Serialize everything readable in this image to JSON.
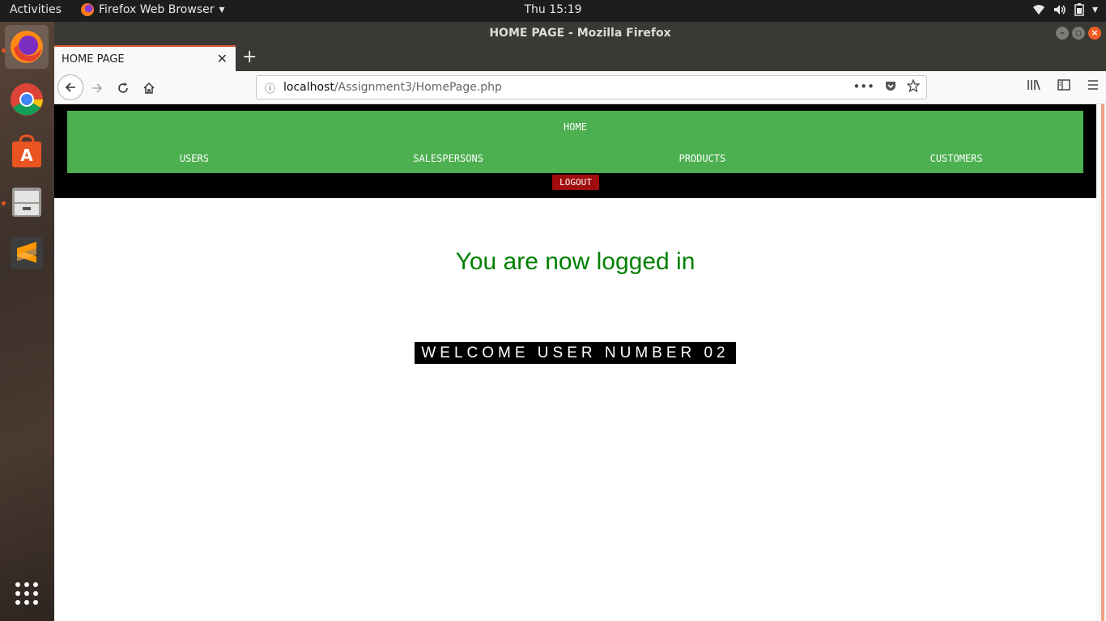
{
  "system": {
    "activities_label": "Activities",
    "app_menu_label": "Firefox Web Browser",
    "clock": "Thu 15:19"
  },
  "window": {
    "title": "HOME PAGE - Mozilla Firefox"
  },
  "browser": {
    "tab_title": "HOME PAGE",
    "url_host": "localhost",
    "url_path": "/Assignment3/HomePage.php"
  },
  "page": {
    "nav": {
      "home": "HOME",
      "items": [
        "USERS",
        "SALESPERSONS",
        "PRODUCTS",
        "CUSTOMERS"
      ],
      "logout": "LOGOUT"
    },
    "status_message": "You are now logged in",
    "welcome_message": "WELCOME USER NUMBER 02"
  },
  "colors": {
    "nav_green": "#4caf50",
    "logout_red": "#a00d0d",
    "status_green": "#008000"
  },
  "icons": {
    "dock": [
      "firefox-icon",
      "chrome-icon",
      "software-center-icon",
      "files-icon",
      "sublime-text-icon",
      "app-grid-icon"
    ],
    "tray": [
      "wifi-icon",
      "volume-icon",
      "battery-icon",
      "system-menu-chevron-icon"
    ]
  }
}
